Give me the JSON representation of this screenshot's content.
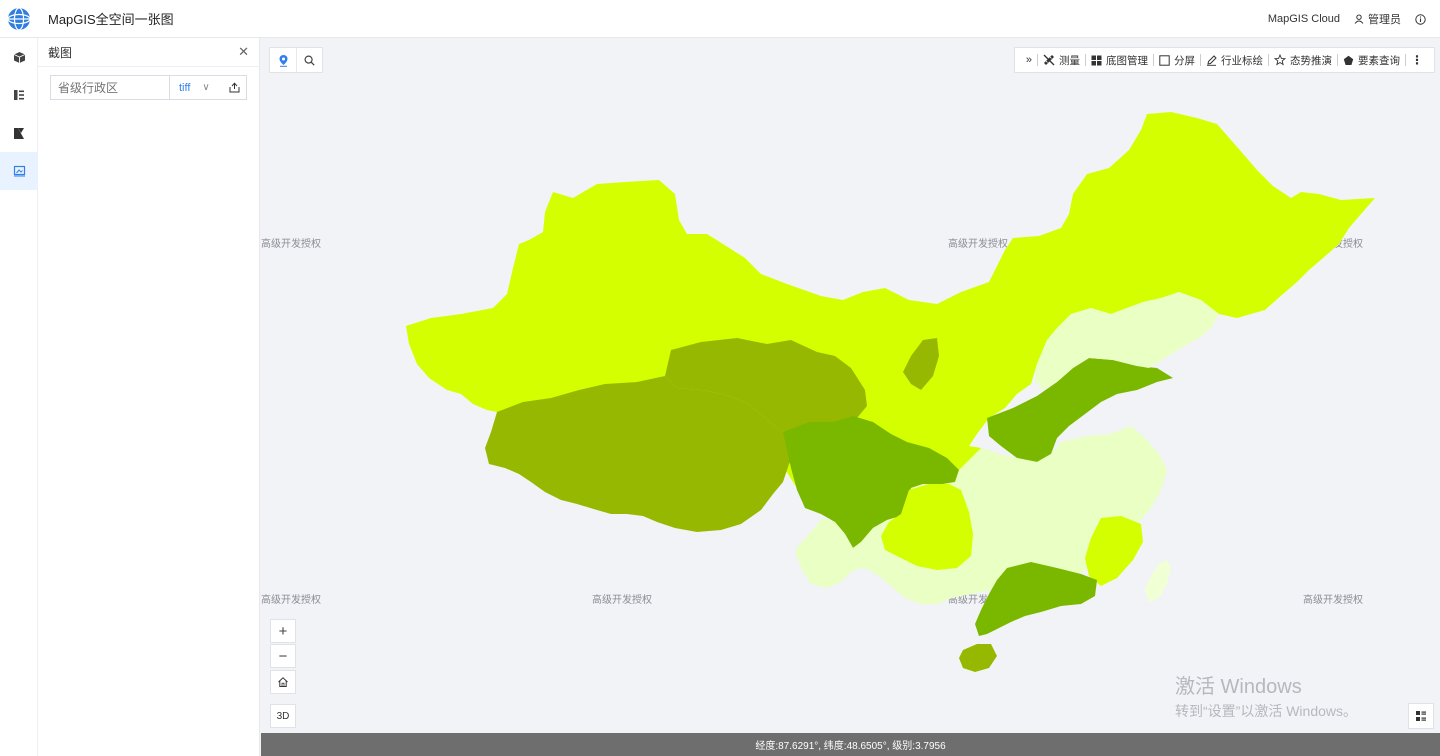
{
  "header": {
    "title": "MapGIS全空间一张图",
    "cloud_label": "MapGIS Cloud",
    "user_label": "管理员"
  },
  "rail": {
    "items": [
      "cube-icon",
      "layers-list-icon",
      "kanban-icon",
      "screenshot-icon"
    ],
    "active_index": 3
  },
  "panel": {
    "title": "截图",
    "clip_input_placeholder": "省级行政区",
    "format_value": "tiff"
  },
  "toolbar": {
    "items": [
      {
        "label": "测量",
        "icon": "ruler-icon"
      },
      {
        "label": "底图管理",
        "icon": "grid-icon"
      },
      {
        "label": "分屏",
        "icon": "split-screen-icon"
      },
      {
        "label": "行业标绘",
        "icon": "pen-icon"
      },
      {
        "label": "态势推演",
        "icon": "star-icon"
      },
      {
        "label": "要素查询",
        "icon": "pentagon-icon"
      }
    ]
  },
  "map": {
    "watermark_text": "高级开发授权",
    "zoom_in": "+",
    "zoom_out": "−",
    "btn_3d": "3D",
    "colors": {
      "lime": "#d4ff00",
      "olive": "#96b800",
      "green": "#7ab800",
      "light": "#eaffc4",
      "pale": "#f1ffd4"
    }
  },
  "os_notice": {
    "line1": "激活 Windows",
    "line2": "转到“设置”以激活 Windows。"
  },
  "status": {
    "text": "经度:87.6291°, 纬度:48.6505°, 级别:3.7956"
  }
}
